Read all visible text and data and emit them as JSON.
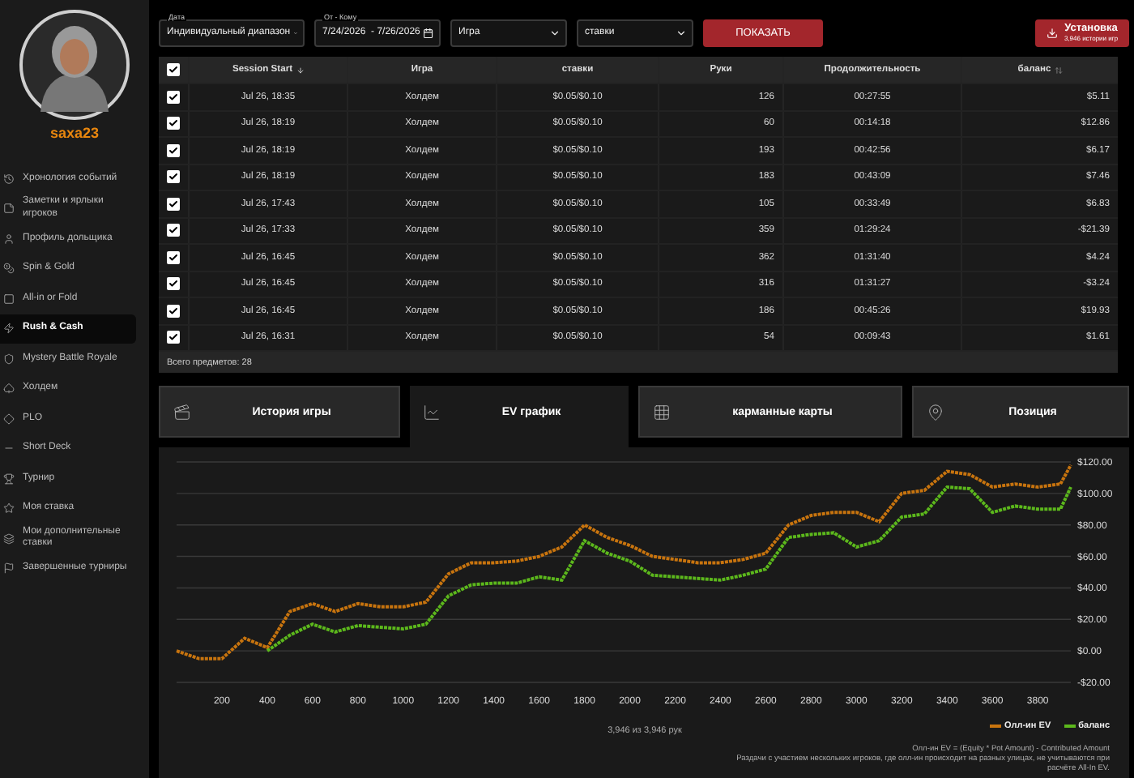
{
  "user": {
    "name": "saxa23"
  },
  "sidebar": {
    "items": [
      {
        "label": "Хронология событий",
        "selected": false
      },
      {
        "label": "Заметки и ярлыки игроков",
        "selected": false
      },
      {
        "label": "Профиль дольщика",
        "selected": false
      },
      {
        "label": "Spin & Gold",
        "selected": false
      },
      {
        "label": "All-in or Fold",
        "selected": false
      },
      {
        "label": "Rush & Cash",
        "selected": true
      },
      {
        "label": "Mystery Battle Royale",
        "selected": false
      },
      {
        "label": "Холдем",
        "selected": false
      },
      {
        "label": "PLO",
        "selected": false
      },
      {
        "label": "Short Deck",
        "selected": false
      },
      {
        "label": "Турнир",
        "selected": false
      },
      {
        "label": "Моя ставка",
        "selected": false
      },
      {
        "label": "Мои дополнительные ставки",
        "selected": false
      },
      {
        "label": "Завершенные турниры",
        "selected": false
      }
    ]
  },
  "filters": {
    "date": {
      "label": "Дата",
      "value": "Индивидуальный диапазон"
    },
    "range": {
      "label": "От - Кому",
      "value": "7/24/2026  - 7/26/2026"
    },
    "game": {
      "value": "Игра"
    },
    "stakes": {
      "value": "ставки"
    },
    "show_button": "ПОКАЗАТЬ",
    "install_button": {
      "label": "Установка",
      "sub": "3,946 истории игр"
    }
  },
  "table": {
    "all_checked": true,
    "columns": [
      "Session Start",
      "Игра",
      "ставки",
      "Руки",
      "Продолжительность",
      "баланс"
    ],
    "rows": [
      {
        "checked": true,
        "cells": [
          "Jul 26, 18:35",
          "Холдем",
          "$0.05/$0.10",
          "126",
          "00:27:55",
          "$5.11"
        ]
      },
      {
        "checked": true,
        "cells": [
          "Jul 26, 18:19",
          "Холдем",
          "$0.05/$0.10",
          "60",
          "00:14:18",
          "$12.86"
        ]
      },
      {
        "checked": true,
        "cells": [
          "Jul 26, 18:19",
          "Холдем",
          "$0.05/$0.10",
          "193",
          "00:42:56",
          "$6.17"
        ]
      },
      {
        "checked": true,
        "cells": [
          "Jul 26, 18:19",
          "Холдем",
          "$0.05/$0.10",
          "183",
          "00:43:09",
          "$7.46"
        ]
      },
      {
        "checked": true,
        "cells": [
          "Jul 26, 17:43",
          "Холдем",
          "$0.05/$0.10",
          "105",
          "00:33:49",
          "$6.83"
        ]
      },
      {
        "checked": true,
        "cells": [
          "Jul 26, 17:33",
          "Холдем",
          "$0.05/$0.10",
          "359",
          "01:29:24",
          "-$21.39"
        ]
      },
      {
        "checked": true,
        "cells": [
          "Jul 26, 16:45",
          "Холдем",
          "$0.05/$0.10",
          "362",
          "01:31:40",
          "$4.24"
        ]
      },
      {
        "checked": true,
        "cells": [
          "Jul 26, 16:45",
          "Холдем",
          "$0.05/$0.10",
          "316",
          "01:31:27",
          "-$3.24"
        ]
      },
      {
        "checked": true,
        "cells": [
          "Jul 26, 16:45",
          "Холдем",
          "$0.05/$0.10",
          "186",
          "00:45:26",
          "$19.93"
        ]
      },
      {
        "checked": true,
        "cells": [
          "Jul 26, 16:31",
          "Холдем",
          "$0.05/$0.10",
          "54",
          "00:09:43",
          "$1.61"
        ]
      }
    ],
    "footer": "Всего предметов: 28"
  },
  "tabs": [
    {
      "label": "История игры",
      "selected": false
    },
    {
      "label": "EV график",
      "selected": true
    },
    {
      "label": "карманные карты",
      "selected": false
    },
    {
      "label": "Позиция",
      "selected": false
    }
  ],
  "ev_panel": {
    "chart_data": {
      "type": "line",
      "grid": true,
      "xlim": [
        0,
        3946
      ],
      "ylim": [
        -20,
        120
      ],
      "x": [
        0,
        100,
        200,
        300,
        400,
        500,
        600,
        700,
        800,
        900,
        1000,
        1100,
        1200,
        1300,
        1400,
        1500,
        1600,
        1700,
        1800,
        1900,
        2000,
        2100,
        2200,
        2300,
        2400,
        2500,
        2600,
        2700,
        2800,
        2900,
        3000,
        3100,
        3200,
        3300,
        3400,
        3500,
        3600,
        3700,
        3800,
        3900,
        3946
      ],
      "series": [
        {
          "name": "Олл-ин EV",
          "color": "#c8740e",
          "line_style": "dashed",
          "values": [
            0,
            -5,
            -5,
            8,
            2,
            25,
            30,
            25,
            30,
            28,
            28,
            31,
            49,
            56,
            56,
            57,
            60,
            66,
            80,
            72,
            67,
            60,
            58,
            56,
            56,
            58,
            62,
            80,
            86,
            88,
            88,
            82,
            100,
            102,
            114,
            112,
            104,
            106,
            104,
            106,
            118
          ]
        },
        {
          "name": "баланс",
          "color": "#5cb81c",
          "line_style": "dashed",
          "values": [
            null,
            null,
            null,
            null,
            0,
            10,
            17,
            12,
            16,
            15,
            14,
            17,
            35,
            42,
            43,
            43,
            47,
            45,
            70,
            62,
            57,
            48,
            47,
            46,
            45,
            48,
            52,
            72,
            74,
            75,
            66,
            70,
            85,
            87,
            104,
            103,
            88,
            92,
            90,
            90,
            104
          ]
        }
      ],
      "xticks": [
        200,
        400,
        600,
        800,
        1000,
        1200,
        1400,
        1600,
        1800,
        2000,
        2200,
        2400,
        2600,
        2800,
        3000,
        3200,
        3400,
        3600,
        3800
      ],
      "yticks": [
        {
          "value": 120,
          "label": "$120.00"
        },
        {
          "value": 100,
          "label": "$100.00"
        },
        {
          "value": 80,
          "label": "$80.00"
        },
        {
          "value": 60,
          "label": "$60.00"
        },
        {
          "value": 40,
          "label": "$40.00"
        },
        {
          "value": 20,
          "label": "$20.00"
        },
        {
          "value": 0,
          "label": "$0.00"
        },
        {
          "value": -20,
          "label": "-$20.00"
        }
      ]
    },
    "hands_count": "3,946 из 3,946 рук",
    "notes": [
      "Олл-ин EV = (Equity * Pot Amount) - Contributed Amount",
      "Раздачи с участием нескольких игроков, где олл-ин происходит на разных улицах, не учитываются при расчёте All-In EV."
    ]
  }
}
